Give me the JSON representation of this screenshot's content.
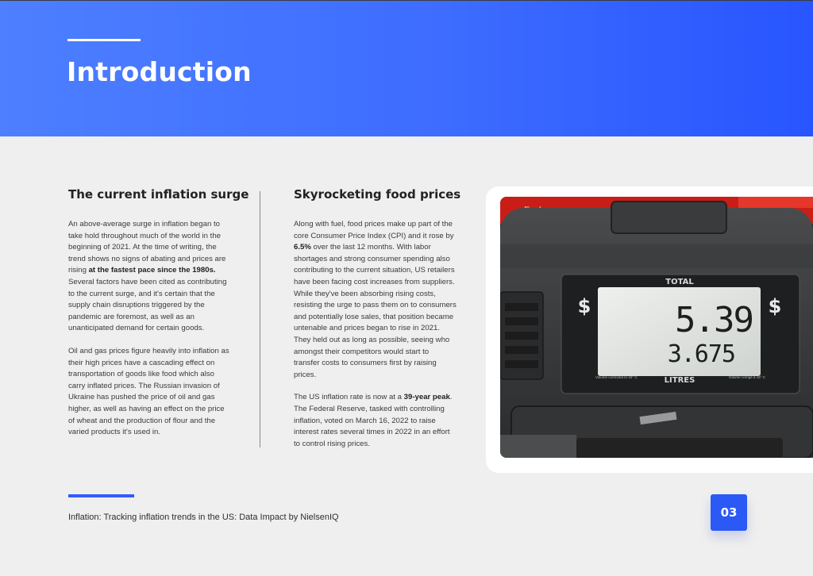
{
  "header": {
    "title": "Introduction"
  },
  "left_column": {
    "heading": "The current inflation surge",
    "p1_a": "An above-average surge in inflation began to take hold throughout much of the world in the beginning of 2021. At the time of writing, the trend shows no signs of abating and prices are rising ",
    "p1_b": "at the fastest pace since the 1980s.",
    "p1_c": " Several factors have been cited as contributing to the current surge, and it's certain that the supply chain disruptions triggered by the pandemic are foremost, as well as an unanticipated demand for certain goods.",
    "p2": "Oil and gas prices figure heavily into inflation as their high prices have a cascading effect on transportation of goods like food which also carry inflated prices. The Russian invasion of Ukraine has pushed the price of oil and gas higher, as well as having an effect on the price of wheat and the production of flour and the varied products it's used in."
  },
  "right_column": {
    "heading": "Skyrocketing food prices",
    "p1_a": "Along with fuel, food prices make up part of the core Consumer Price Index (CPI) and it rose by ",
    "p1_b": "6.5%",
    "p1_c": " over the last 12 months. With labor shortages and strong consumer spending also contributing to the current situation, US retailers have been facing cost increases from suppliers. While they've been absorbing rising costs, resisting the urge to pass them on to consumers and potentially lose sales, that position became untenable and prices began to rise in 2021. They held out as long as possible, seeing who amongst their competitors would start to transfer costs to consumers first by raising prices.",
    "p2_a": "The US inflation rate is now at a ",
    "p2_b": "39-year peak",
    "p2_c": ". The Federal Reserve, tasked with controlling inflation, voted on March 16, 2022 to raise interest rates several times in 2022 in an effort to control rising prices."
  },
  "photo": {
    "top_label": "Each",
    "total_label": "TOTAL",
    "currency": "$",
    "price": "5.39",
    "volume": "3.675",
    "litres_label": "LITRES",
    "note_left": "Volume corrected to 15° C",
    "note_right": "Volume corrigé à 15° C"
  },
  "footer": {
    "text": "Inflation: Tracking inflation trends in the US: Data Impact by NielsenIQ",
    "page_number": "03"
  },
  "colors": {
    "brand_blue": "#2b59f6",
    "header_gradient_start": "#4d7fff",
    "header_gradient_end": "#2855ff"
  }
}
